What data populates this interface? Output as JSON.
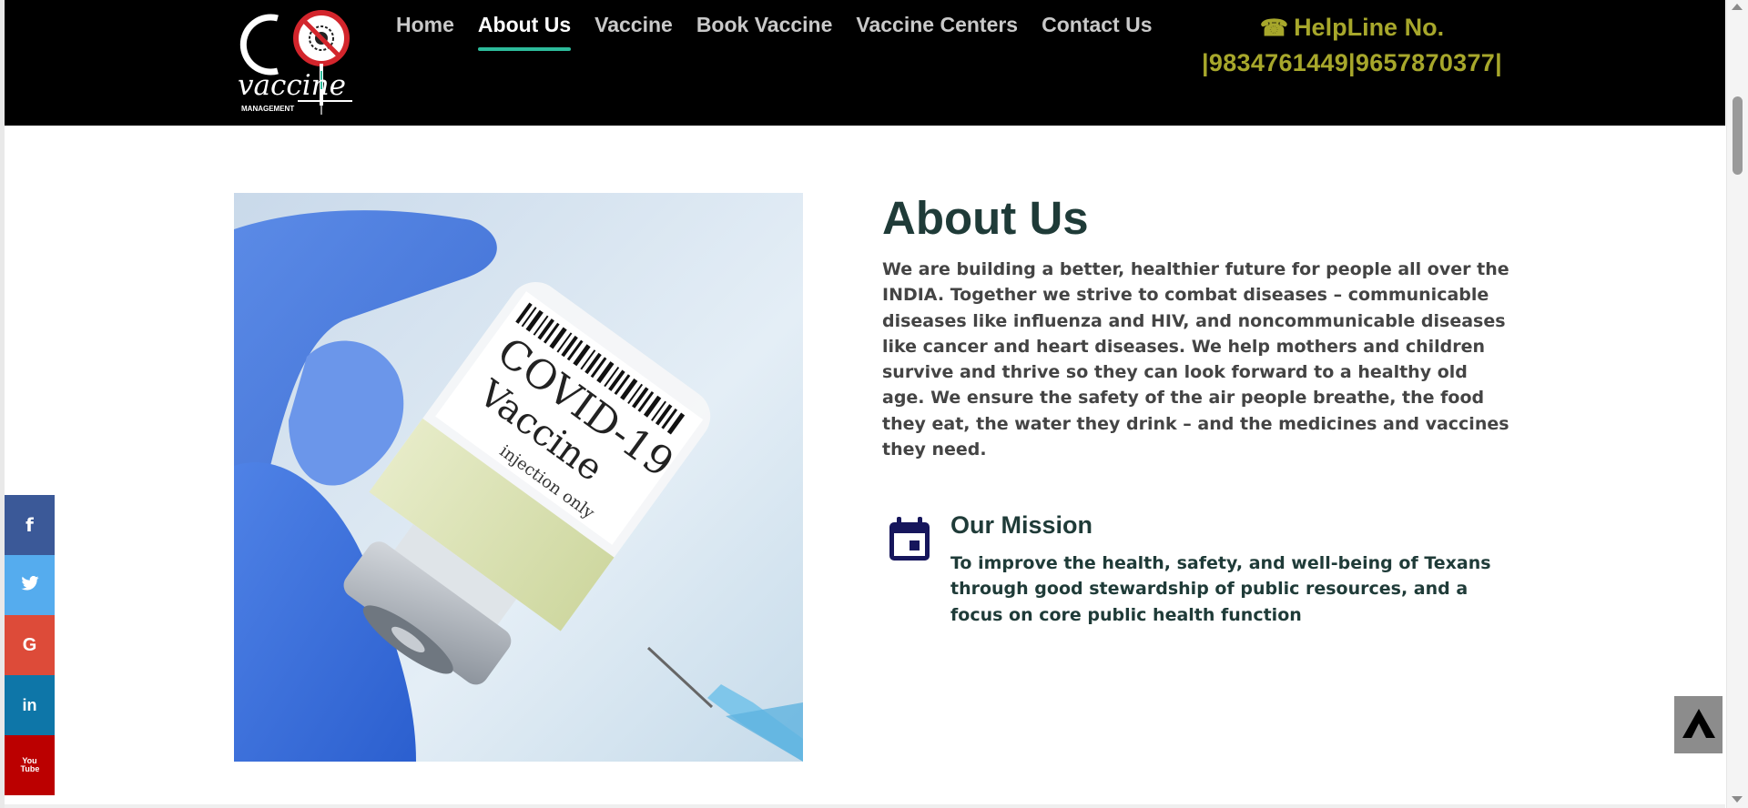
{
  "header": {
    "logo_text_main": "vaccine",
    "logo_text_sub": "MANAGEMENT",
    "nav": [
      {
        "label": "Home",
        "active": false
      },
      {
        "label": "About Us",
        "active": true
      },
      {
        "label": "Vaccine",
        "active": false
      },
      {
        "label": "Book Vaccine",
        "active": false
      },
      {
        "label": "Vaccine Centers",
        "active": false
      },
      {
        "label": "Contact Us",
        "active": false
      }
    ],
    "helpline_label": "HelpLine No.",
    "helpline_numbers": "|9834761449|9657870377|",
    "helpline_color": "#a7a72b",
    "active_underline_color": "#2dbb9b"
  },
  "main": {
    "image_label_line1": "COVID-19",
    "image_label_line2": "Vaccine",
    "image_label_line3": "injection only",
    "about_title": "About Us",
    "about_text": "We are building a better, healthier future for people all over the INDIA. Together we strive to combat diseases – communicable diseases like influenza and HIV, and noncommunicable diseases like cancer and heart diseases. We help mothers and children survive and thrive so they can look forward to a healthy old age. We ensure the safety of the air people breathe, the food they eat, the water they drink – and the medicines and vaccines they need.",
    "mission_title": "Our Mission",
    "mission_text": "To improve the health, safety, and well-being of Texans through good stewardship of public resources, and a focus on core public health function",
    "mission_icon": "calendar-icon"
  },
  "social": [
    {
      "name": "facebook",
      "glyph": "f",
      "color": "#3b5998"
    },
    {
      "name": "twitter",
      "glyph": "t",
      "color": "#55acee"
    },
    {
      "name": "google",
      "glyph": "G",
      "color": "#dd4b39"
    },
    {
      "name": "linkedin",
      "glyph": "in",
      "color": "#0e76a8"
    },
    {
      "name": "youtube",
      "glyph": "You Tube",
      "color": "#bb0000"
    }
  ],
  "back_to_top_icon": "chevron-up-icon"
}
